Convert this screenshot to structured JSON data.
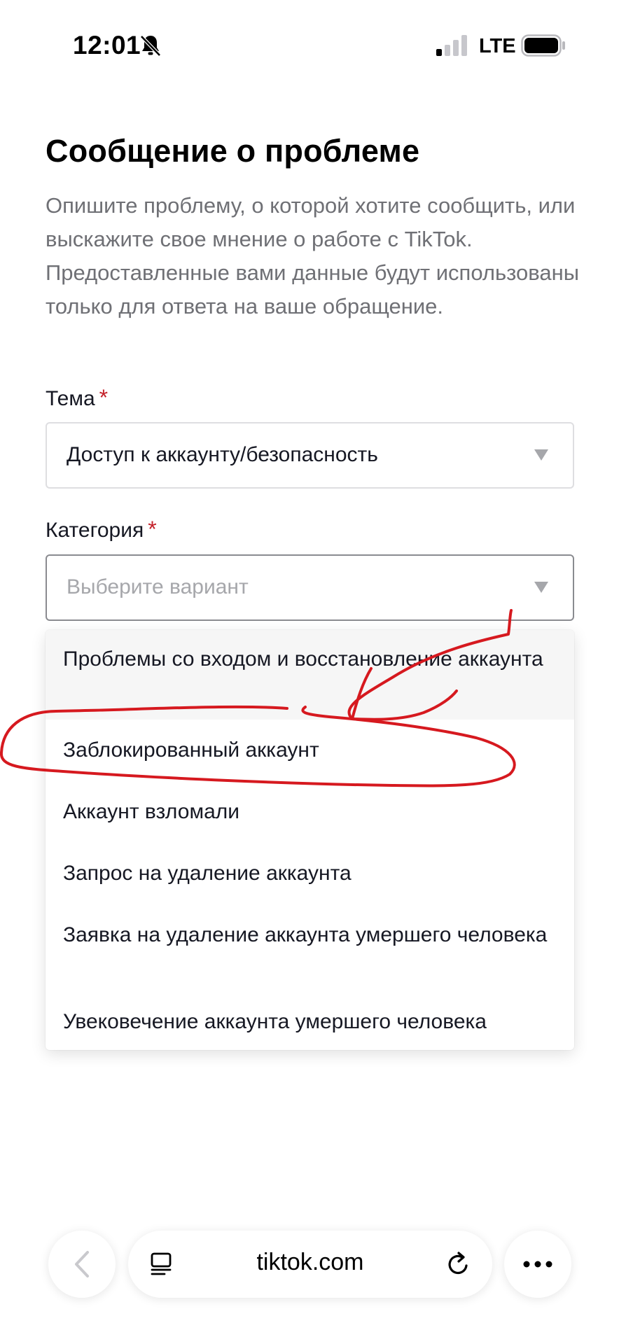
{
  "status_bar": {
    "time": "12:01",
    "network": "LTE",
    "icons": [
      "bell-slash-icon",
      "signal-icon",
      "battery-icon"
    ]
  },
  "page": {
    "title": "Сообщение о проблеме",
    "description": "Опишите проблему, о которой хотите сообщить, или выскажите свое мнение о работе с TikTok. Предоставленные вами данные будут использованы только для ответа на ваше обращение."
  },
  "form": {
    "topic": {
      "label": "Тема",
      "required_mark": "*",
      "value": "Доступ к аккаунту/безопасность"
    },
    "category": {
      "label": "Категория",
      "required_mark": "*",
      "placeholder": "Выберите вариант",
      "options": [
        "Проблемы со входом и восстановление аккаунта",
        "Заблокированный аккаунт",
        "Аккаунт взломали",
        "Запрос на удаление аккаунта",
        "Заявка на удаление аккаунта умершего человека",
        "Увековечение аккаунта умершего человека"
      ]
    }
  },
  "browser": {
    "url": "tiktok.com",
    "icons": [
      "back-arrow-icon",
      "reader-mode-icon",
      "reload-icon",
      "more-dots-icon"
    ]
  },
  "colors": {
    "required_star": "#c4222b",
    "annotation": "#d6191f",
    "description_text": "#6f7075"
  }
}
